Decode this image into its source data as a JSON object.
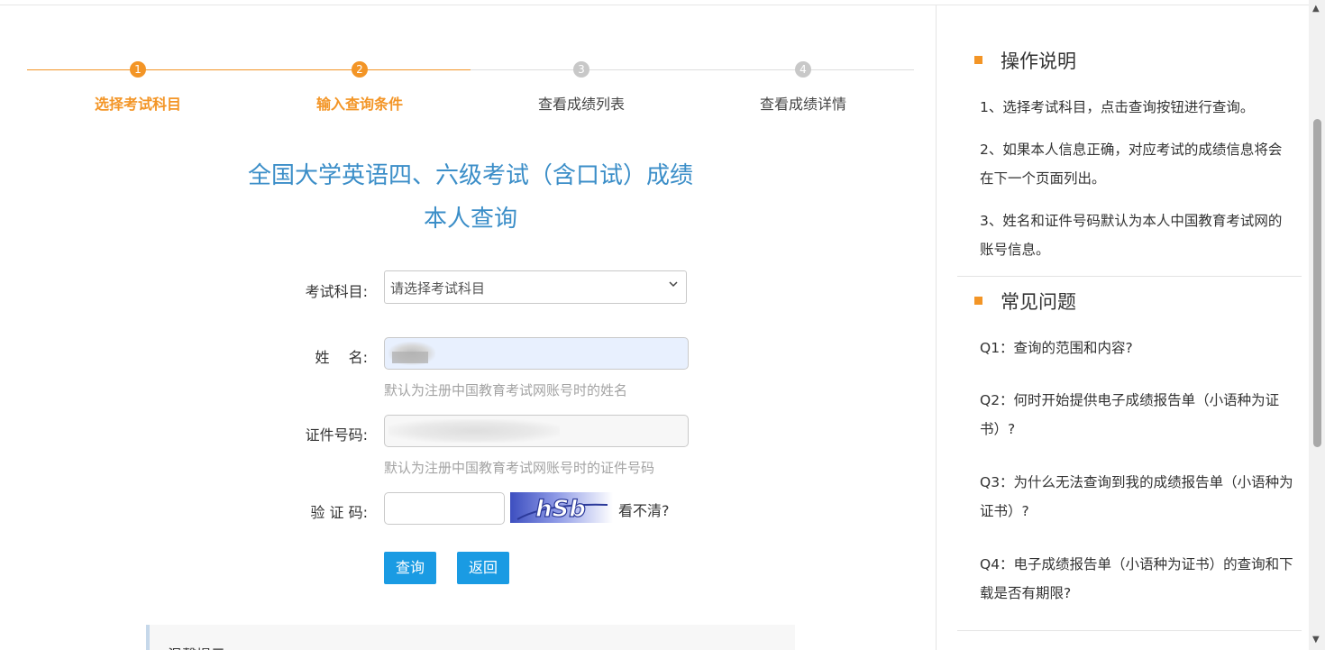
{
  "steps": [
    {
      "num": "1",
      "label": "选择考试科目",
      "state": "active"
    },
    {
      "num": "2",
      "label": "输入查询条件",
      "state": "active"
    },
    {
      "num": "3",
      "label": "查看成绩列表",
      "state": "inactive"
    },
    {
      "num": "4",
      "label": "查看成绩详情",
      "state": "inactive"
    }
  ],
  "title": {
    "line1": "全国大学英语四、六级考试（含口试）成绩",
    "line2": "本人查询"
  },
  "form": {
    "subject_label": "考试科目:",
    "subject_placeholder": "请选择考试科目",
    "name_label": "姓　 名:",
    "name_hint": "默认为注册中国教育考试网账号时的姓名",
    "id_label": "证件号码:",
    "id_hint": "默认为注册中国教育考试网账号时的证件号码",
    "captcha_label": "验 证 码:",
    "captcha_text": "hSb",
    "refresh_label": "看不清?",
    "query_button": "查询",
    "back_button": "返回"
  },
  "tip": {
    "title": "温馨提示"
  },
  "sidebar": {
    "instructions_title": "操作说明",
    "instructions": [
      "1、选择考试科目，点击查询按钮进行查询。",
      "2、如果本人信息正确，对应考试的成绩信息将会在下一个页面列出。",
      "3、姓名和证件号码默认为本人中国教育考试网的账号信息。"
    ],
    "faq_title": "常见问题",
    "faq": [
      "Q1：查询的范围和内容?",
      "Q2：何时开始提供电子成绩报告单（小语种为证书）?",
      "Q3：为什么无法查询到我的成绩报告单（小语种为证书）?",
      "Q4：电子成绩报告单（小语种为证书）的查询和下载是否有期限?"
    ]
  },
  "colors": {
    "accent_orange": "#f39526",
    "title_blue": "#3b8ec8",
    "button_blue": "#1a9be3"
  }
}
